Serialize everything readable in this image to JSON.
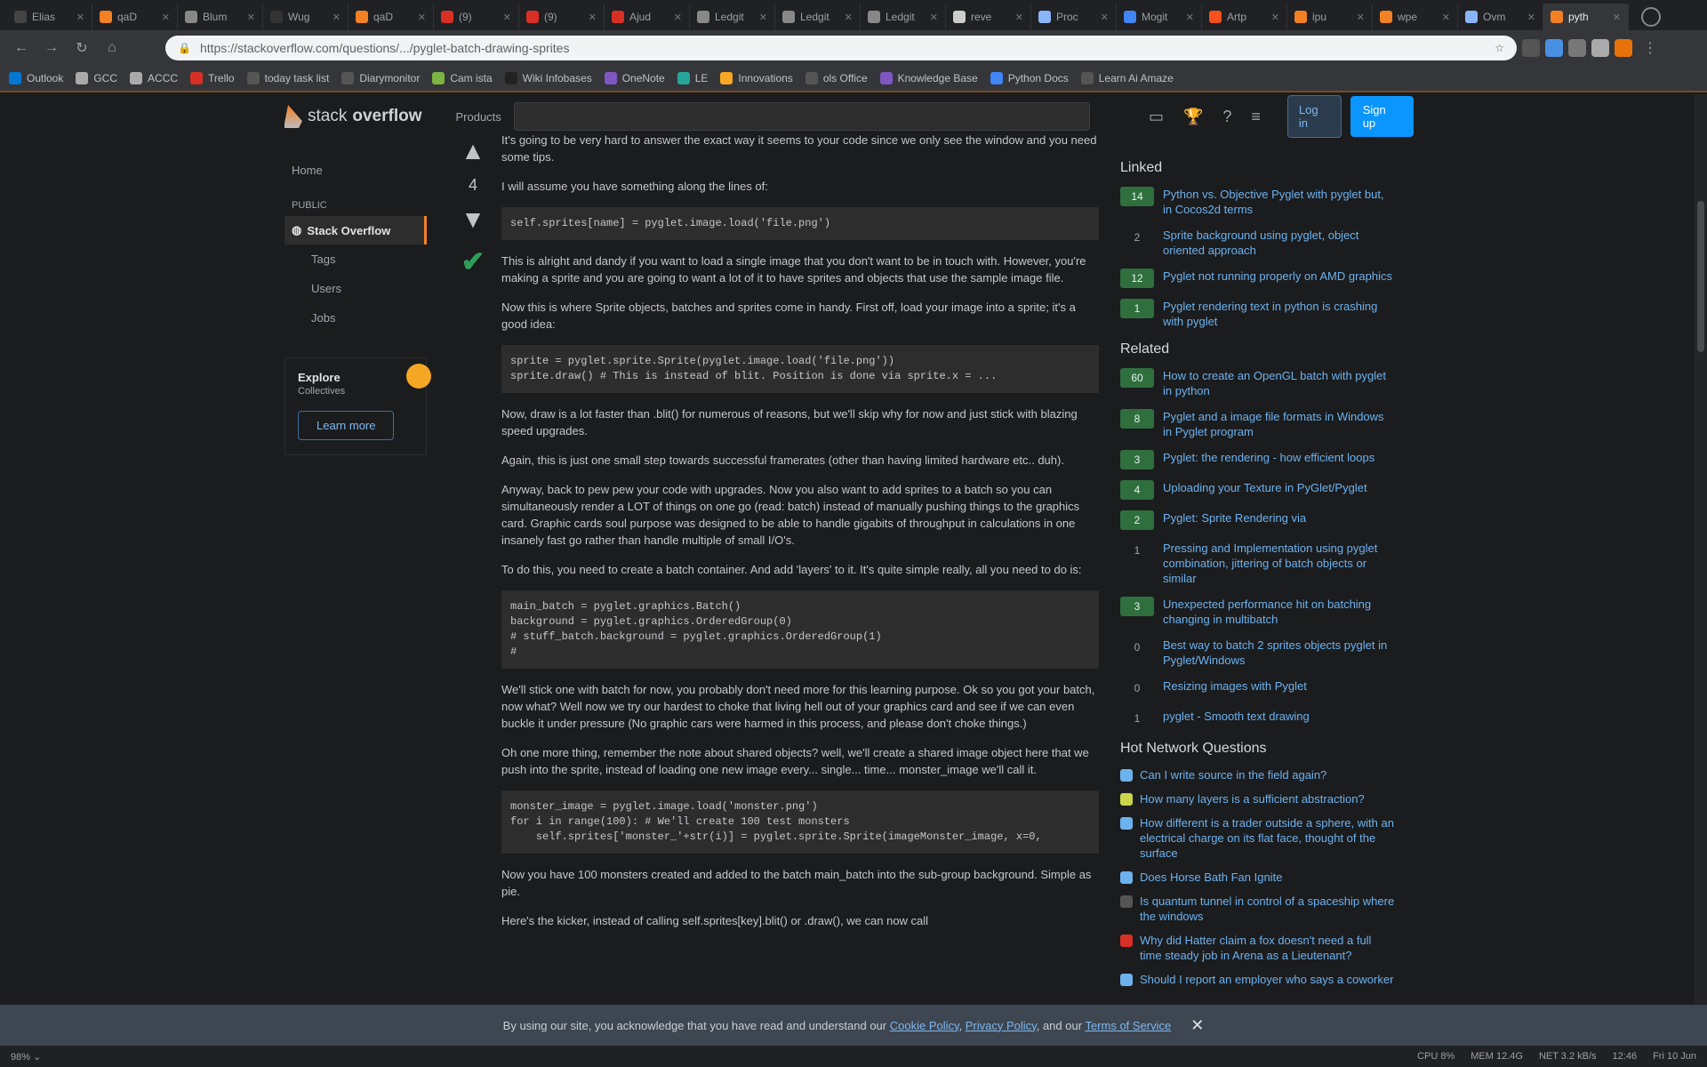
{
  "tabs": [
    {
      "label": "Elias",
      "color": "#444444"
    },
    {
      "label": "qaD",
      "color": "#f48024"
    },
    {
      "label": "Blum",
      "color": "#888888"
    },
    {
      "label": "Wug",
      "color": "#333333"
    },
    {
      "label": "qaD",
      "color": "#f48024"
    },
    {
      "label": "(9)",
      "color": "#d93025"
    },
    {
      "label": "(9)",
      "color": "#d93025"
    },
    {
      "label": "Ajud",
      "color": "#d93025"
    },
    {
      "label": "Ledgit",
      "color": "#888888"
    },
    {
      "label": "Ledgit",
      "color": "#888888"
    },
    {
      "label": "Ledgit",
      "color": "#888888"
    },
    {
      "label": "reve",
      "color": "#cccccc"
    },
    {
      "label": "Proc",
      "color": "#8ab4f8"
    },
    {
      "label": "Mogit",
      "color": "#4285f4"
    },
    {
      "label": "Artp",
      "color": "#f4511e"
    },
    {
      "label": "ipu",
      "color": "#f48024"
    },
    {
      "label": "wpe",
      "color": "#f48024"
    },
    {
      "label": "Ovm",
      "color": "#8ab4f8"
    },
    {
      "label": "pyth",
      "color": "#f48024"
    }
  ],
  "url": "https://stackoverflow.com/questions/.../pyglet-batch-drawing-sprites",
  "bookmarks": [
    {
      "label": "Outlook",
      "color": "#0078d4"
    },
    {
      "label": "GCC",
      "color": "#aaaaaa"
    },
    {
      "label": "ACCC",
      "color": "#aaaaaa"
    },
    {
      "label": "Trello",
      "color": "#d93025"
    },
    {
      "label": "today task list",
      "color": "#555555"
    },
    {
      "label": "Diarymonitor",
      "color": "#555555"
    },
    {
      "label": "Cam ista",
      "color": "#7cb342"
    },
    {
      "label": "Wiki Infobases",
      "color": "#222222"
    },
    {
      "label": "OneNote",
      "color": "#7e57c2"
    },
    {
      "label": "LE",
      "color": "#26a69a"
    },
    {
      "label": "Innovations",
      "color": "#f9a825"
    },
    {
      "label": "ols Office",
      "color": "#555555"
    },
    {
      "label": "Knowledge Base",
      "color": "#7e57c2"
    },
    {
      "label": "Python Docs",
      "color": "#4285f4"
    },
    {
      "label": "Learn Ai Amaze",
      "color": "#555555"
    }
  ],
  "header": {
    "logo_light": "stack",
    "logo_bold": "overflow",
    "products": "Products",
    "login": "Log in",
    "signup": "Sign up"
  },
  "left_nav": {
    "home": "Home",
    "public": "PUBLIC",
    "questions": "Stack Overflow",
    "tags": "Tags",
    "users": "Users",
    "jobs": "Jobs",
    "collectives_title": "Explore",
    "collectives_sub": "Collectives",
    "learn_more": "Learn more"
  },
  "vote": {
    "count": "4"
  },
  "answer": {
    "p1": "It's going to be very hard to answer the exact way it seems to your code since we only see the window and you need some tips.",
    "p2": "I will assume you have something along the lines of:",
    "code1": "self.sprites[name] = pyglet.image.load('file.png')",
    "p3": "This is alright and dandy if you want to load a single image that you don't want to be in touch with. However, you're making a sprite and you are going to want a lot of it to have sprites and objects that use the sample image file.",
    "p4": "Now this is where Sprite objects, batches and sprites come in handy. First off, load your image into a sprite; it's a good idea:",
    "code2": "sprite = pyglet.sprite.Sprite(pyglet.image.load('file.png'))\nsprite.draw() # This is instead of blit. Position is done via sprite.x = ...",
    "p5": "Now, draw is a lot faster than .blit() for numerous of reasons, but we'll skip why for now and just stick with blazing speed upgrades.",
    "p6": "Again, this is just one small step towards successful framerates (other than having limited hardware etc.. duh).",
    "p7": "Anyway, back to pew pew your code with upgrades. Now you also want to add sprites to a batch so you can simultaneously render a LOT of things on one go (read: batch) instead of manually pushing things to the graphics card. Graphic cards soul purpose was designed to be able to handle gigabits of throughput in calculations in one insanely fast go rather than handle multiple of small I/O's.",
    "p8": "To do this, you need to create a batch container. And add 'layers' to it. It's quite simple really, all you need to do is:",
    "code3": "main_batch = pyglet.graphics.Batch()\nbackground = pyglet.graphics.OrderedGroup(0)\n# stuff_batch.background = pyglet.graphics.OrderedGroup(1)\n#",
    "p9": "We'll stick one with batch for now, you probably don't need more for this learning purpose. Ok so you got your batch, now what? Well now we try our hardest to choke that living hell out of your graphics card and see if we can even buckle it under pressure (No graphic cars were harmed in this process, and please don't choke things.)",
    "p10": "Oh one more thing, remember the note about shared objects? well, we'll create a shared image object here that we push into the sprite, instead of loading one new image every... single... time... monster_image we'll call it.",
    "code4": "monster_image = pyglet.image.load('monster.png')\nfor i in range(100): # We'll create 100 test monsters\n    self.sprites['monster_'+str(i)] = pyglet.sprite.Sprite(imageMonster_image, x=0,\n",
    "p11": "Now you have 100 monsters created and added to the batch main_batch into the sub-group background. Simple as pie.",
    "p12": "Here's the kicker, instead of calling self.sprites[key].blit() or .draw(), we can now call"
  },
  "sidebar": {
    "linked_title": "Linked",
    "linked": [
      {
        "score": "14",
        "answered": true,
        "title": "Python vs. Objective Pyglet with pyglet but, in Cocos2d terms"
      },
      {
        "score": "2",
        "answered": false,
        "title": "Sprite background using pyglet, object oriented approach"
      },
      {
        "score": "12",
        "answered": true,
        "title": "Pyglet not running properly on AMD graphics"
      },
      {
        "score": "1",
        "answered": true,
        "title": "Pyglet rendering text in python is crashing with pyglet"
      }
    ],
    "related_title": "Related",
    "related": [
      {
        "score": "60",
        "answered": true,
        "title": "How to create an OpenGL batch with pyglet in python"
      },
      {
        "score": "8",
        "answered": true,
        "title": "Pyglet and a image file formats in Windows in Pyglet program"
      },
      {
        "score": "3",
        "answered": true,
        "title": "Pyglet: the rendering - how efficient loops"
      },
      {
        "score": "4",
        "answered": true,
        "title": "Uploading your Texture in PyGlet/Pyglet"
      },
      {
        "score": "2",
        "answered": true,
        "title": "Pyglet: Sprite Rendering via"
      },
      {
        "score": "1",
        "answered": false,
        "title": "Pressing and Implementation using pyglet combination, jittering of batch objects or similar"
      },
      {
        "score": "3",
        "answered": true,
        "title": "Unexpected performance hit on batching changing in multibatch"
      },
      {
        "score": "0",
        "answered": false,
        "title": "Best way to batch 2 sprites objects pyglet in Pyglet/Windows"
      },
      {
        "score": "0",
        "answered": false,
        "title": "Resizing images with Pyglet"
      },
      {
        "score": "1",
        "answered": false,
        "title": "pyglet - Smooth text drawing"
      }
    ],
    "hot_title": "Hot Network Questions",
    "hot": [
      {
        "color": "#6cb2ef",
        "title": "Can I write source in the field again?"
      },
      {
        "color": "#c9d649",
        "title": "How many layers is a sufficient abstraction?"
      },
      {
        "color": "#6cb2ef",
        "title": "How different is a trader outside a sphere, with an electrical charge on its flat face, thought of the surface"
      },
      {
        "color": "#6cb2ef",
        "title": "Does Horse Bath Fan Ignite"
      },
      {
        "color": "#555555",
        "title": "Is quantum tunnel in control of a spaceship where the windows"
      },
      {
        "color": "#d93025",
        "title": "Why did Hatter claim a fox doesn't need a full time steady job in Arena as a Lieutenant?"
      },
      {
        "color": "#6cb2ef",
        "title": "Should I report an employer who says a coworker"
      }
    ]
  },
  "cookie": {
    "text": "By using our site, you acknowledge that you have read and understand our",
    "cookie_policy": "Cookie Policy",
    "privacy_policy": "Privacy Policy",
    "and_our": ", and our",
    "terms": "Terms of Service",
    "close": "✕"
  },
  "status": {
    "left": "98% ⌄",
    "right1": "CPU 8%",
    "right2": "MEM 12.4G",
    "right3": "NET 3.2 kB/s",
    "right4": "12:46",
    "right5": "Fri 10 Jun"
  }
}
